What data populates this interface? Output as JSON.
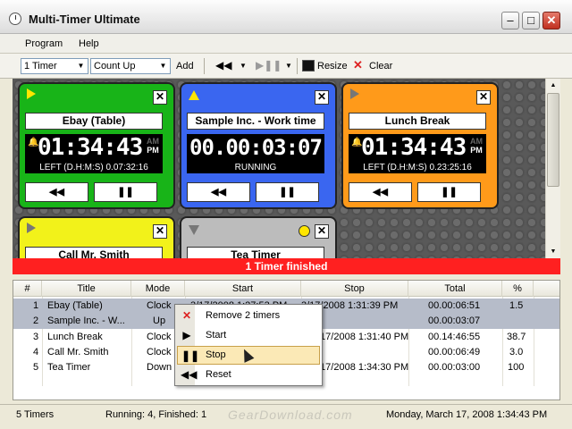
{
  "window": {
    "title": "Multi-Timer Ultimate"
  },
  "menu": {
    "program": "Program",
    "help": "Help"
  },
  "toolbar": {
    "timer_select": "1 Timer",
    "mode_select": "Count Up",
    "add": "Add",
    "resize": "Resize",
    "clear": "Clear"
  },
  "timers": [
    {
      "name": "Ebay (Table)",
      "color": "#18b418",
      "display": "01:34:43",
      "am": "AM",
      "pm": "PM",
      "sub": "LEFT (D.H:M:S) 0.07:32:16",
      "btn_left": "◀◀",
      "btn_right": "❚❚"
    },
    {
      "name": "Sample Inc. - Work time",
      "color": "#3a66f0",
      "display": "00.00:03:07",
      "sub": "RUNNING",
      "btn_left": "◀◀",
      "btn_right": "❚❚"
    },
    {
      "name": "Lunch Break",
      "color": "#ff9a1a",
      "display": "01:34:43",
      "am": "AM",
      "pm": "PM",
      "sub": "LEFT (D.H:M:S) 0.23:25:16",
      "btn_left": "◀◀",
      "btn_right": "❚❚"
    },
    {
      "name": "Call Mr. Smith",
      "color": "#f2f21a"
    },
    {
      "name": "Tea Timer",
      "color": "#bcbcbc"
    }
  ],
  "banner": "1 Timer finished",
  "table": {
    "headers": [
      "#",
      "Title",
      "Mode",
      "Start",
      "Stop",
      "Total",
      "%"
    ],
    "rows": [
      {
        "num": "1",
        "title": "Ebay (Table)",
        "mode": "Clock",
        "start": "3/17/2008 1:27:53 PM",
        "stop": "3/17/2008 1:31:39 PM",
        "total": "00.00:06:51",
        "pct": "1.5"
      },
      {
        "num": "2",
        "title": "Sample Inc. - W...",
        "mode": "Up",
        "start": "",
        "stop": "",
        "total": "00.00:03:07",
        "pct": ""
      },
      {
        "num": "3",
        "title": "Lunch Break",
        "mode": "Clock",
        "start": "",
        "stop": "/17/2008 1:31:40 PM",
        "total": "00.14:46:55",
        "pct": "38.7"
      },
      {
        "num": "4",
        "title": "Call Mr. Smith",
        "mode": "Clock",
        "start": "",
        "stop": "",
        "total": "00.00:06:49",
        "pct": "3.0"
      },
      {
        "num": "5",
        "title": "Tea Timer",
        "mode": "Down",
        "start": "",
        "stop": "/17/2008 1:34:30 PM",
        "total": "00.00:03:00",
        "pct": "100"
      }
    ]
  },
  "context_menu": {
    "items": [
      "Remove 2 timers",
      "Start",
      "Stop",
      "Reset"
    ]
  },
  "status": {
    "count": "5 Timers",
    "summary": "Running: 4, Finished: 1",
    "datetime": "Monday, March 17, 2008 1:34:43 PM"
  },
  "watermark": "GearDownload.com"
}
